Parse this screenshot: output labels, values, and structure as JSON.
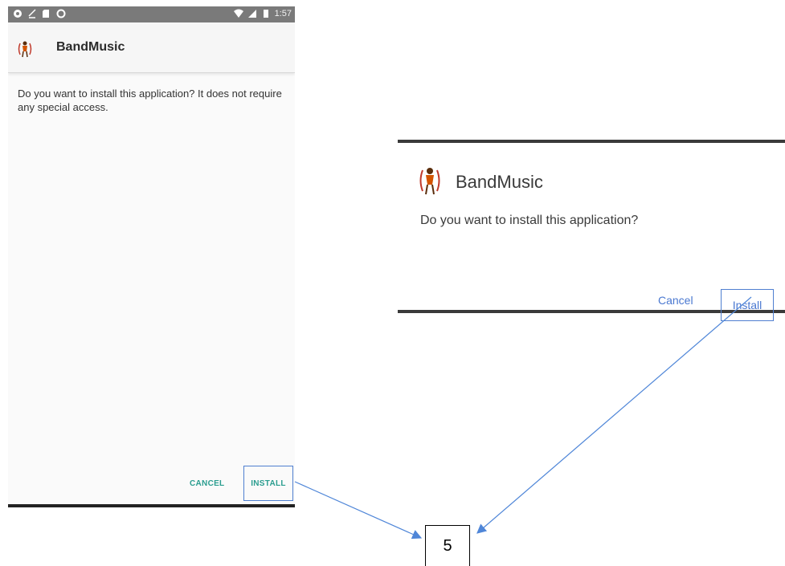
{
  "phone": {
    "status_time": "1:57",
    "app_name": "BandMusic",
    "message": "Do you want to install this application? It does not require any special access.",
    "cancel_label": "CANCEL",
    "install_label": "INSTALL"
  },
  "dialog": {
    "app_name": "BandMusic",
    "message": "Do you want to install this application?",
    "cancel_label": "Cancel",
    "install_label": "Install"
  },
  "step": {
    "number": "5"
  },
  "colors": {
    "accent_teal": "#2a9d8f",
    "accent_blue": "#4a78d0",
    "highlight_border": "#4f7fd0"
  }
}
